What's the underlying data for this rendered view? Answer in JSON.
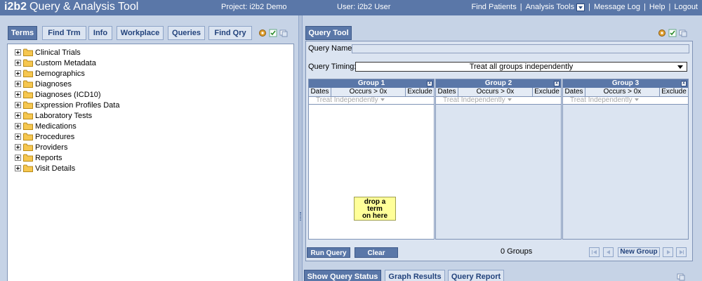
{
  "header": {
    "logo": "i2b2",
    "app_title": "Query & Analysis Tool",
    "project": "Project: i2b2 Demo",
    "user": "User: i2b2 User",
    "nav": {
      "find_patients": "Find Patients",
      "analysis_tools": "Analysis Tools",
      "message_log": "Message Log",
      "help": "Help",
      "logout": "Logout",
      "separator": "|"
    }
  },
  "left_tabs": {
    "terms": "Terms",
    "find_trm": "Find Trm",
    "info": "Info",
    "workplace": "Workplace",
    "queries": "Queries",
    "find_qry": "Find Qry"
  },
  "tree": {
    "items": [
      "Clinical Trials",
      "Custom Metadata",
      "Demographics",
      "Diagnoses",
      "Diagnoses (ICD10)",
      "Expression Profiles Data",
      "Laboratory Tests",
      "Medications",
      "Procedures",
      "Providers",
      "Reports",
      "Visit Details"
    ]
  },
  "query_tool": {
    "tab": "Query Tool",
    "name_label": "Query Name:",
    "name_value": "",
    "timing_label": "Query Timing:",
    "timing_value": "Treat all groups independently",
    "groups": [
      {
        "title": "Group 1",
        "close": "x",
        "dates": "Dates",
        "occurs": "Occurs > 0x",
        "exclude": "Exclude",
        "mode": "Treat Independently",
        "hint_line1": "drop a",
        "hint_line2": "term",
        "hint_line3": "on here"
      },
      {
        "title": "Group 2",
        "close": "x",
        "dates": "Dates",
        "occurs": "Occurs > 0x",
        "exclude": "Exclude",
        "mode": "Treat Independently"
      },
      {
        "title": "Group 3",
        "close": "x",
        "dates": "Dates",
        "occurs": "Occurs > 0x",
        "exclude": "Exclude",
        "mode": "Treat Independently"
      }
    ],
    "run_query": "Run Query",
    "clear": "Clear",
    "groups_count": "0 Groups",
    "new_group": "New Group"
  },
  "bottom_tabs": {
    "show_query_status": "Show Query Status",
    "graph_results": "Graph Results",
    "query_report": "Query Report"
  },
  "colors": {
    "accent": "#5a77a8",
    "panel": "#dbe4f1",
    "background": "#c6d3e6",
    "hint": "#ffff99"
  }
}
